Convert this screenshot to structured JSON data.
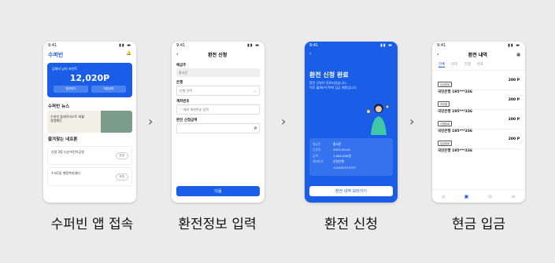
{
  "status_time": "9:41",
  "steps": [
    {
      "caption": "수퍼빈 앱 접속"
    },
    {
      "caption": "환전정보 입력"
    },
    {
      "caption": "환전 신청"
    },
    {
      "caption": "현금 입금"
    }
  ],
  "chevron": "›",
  "p1": {
    "brand": "수퍼빈",
    "bell": "🔔",
    "balance_label": "김체리 님의 포인트",
    "balance": "12,020P",
    "btn1": "환전하기",
    "btn2": "적립내역",
    "news_title": "수퍼빈 뉴스",
    "news_text": "수퍼빈 플레이리스트 재활용캠페인",
    "fav_title": "즐겨찾는 네프론",
    "fav1": "신정 3동 다산어린이공원",
    "fav2": "수서1동 행정복지센터",
    "fav_btn": "운영"
  },
  "p2": {
    "title": "환전 신청",
    "f1_label": "예금주",
    "f1_value": "홍서준",
    "f2_label": "은행",
    "f2_value": "은행 선택",
    "f3_label": "계좌번호",
    "f3_value": "'-' 제외 계좌번호 입력",
    "f4_label": "환전 신청금액",
    "f4_value": "P",
    "button": "다음"
  },
  "p3": {
    "title": "환전 신청 완료",
    "desc1": "환전 신청이 완료되었습니다.",
    "desc2": "이후 월/화/수/목에 입금 예정입니다.",
    "k1": "예금주",
    "v1": "홍서준",
    "k2": "신청일",
    "v2": "2023.09.04",
    "k3": "금액",
    "v3": "1,000,000원",
    "k4": "계좌번호",
    "v4": "신한은행",
    "v5": "110202373737",
    "button": "환전 내역 보러가기"
  },
  "p4": {
    "title": "환전 내역",
    "tabs": [
      "전체",
      "처리",
      "진행",
      "완료"
    ],
    "deposits": [
      {
        "badge": "입금완료",
        "bank": "국민은행 195***336",
        "amount": "200 P"
      },
      {
        "badge": "처리중",
        "bank": "국민은행 195***336",
        "amount": "200 P"
      },
      {
        "badge": "신청완료",
        "bank": "국민은행 195***336",
        "amount": "200 P"
      },
      {
        "badge": "입금완료",
        "bank": "국민은행 195***336",
        "amount": "200 P"
      }
    ]
  }
}
